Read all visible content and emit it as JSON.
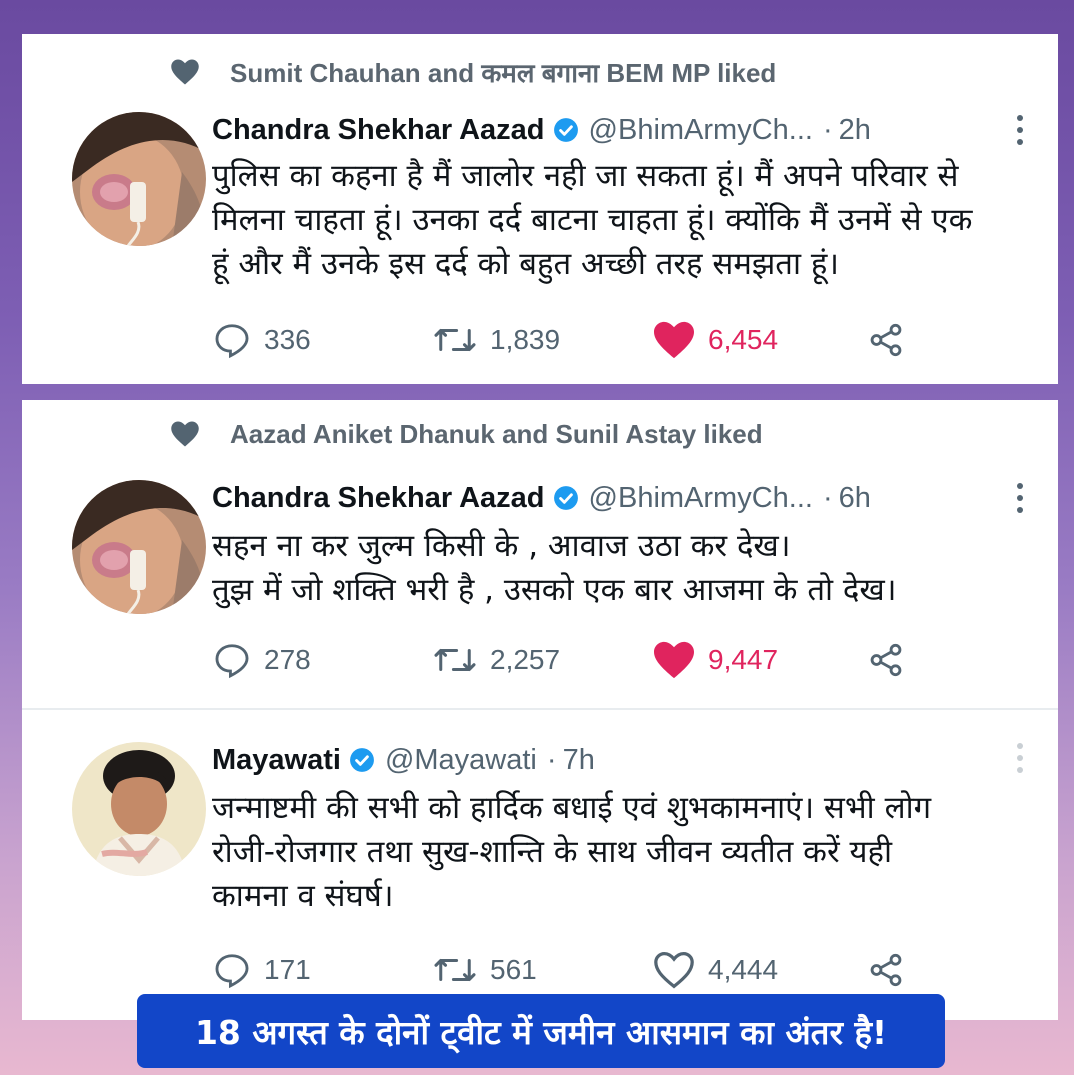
{
  "tweets": [
    {
      "social_context": "Sumit Chauhan and कमल बगाना BEM MP liked",
      "author_name": "Chandra Shekhar Aazad",
      "handle": "@BhimArmyCh...",
      "time": "2h",
      "lines": [
        "पुलिस का कहना है मैं जालोर नही जा सकता हूं। मैं अपने परिवार से",
        "मिलना चाहता हूं। उनका दर्द बाटना चाहता हूं। क्योंकि मैं उनमें से एक",
        "हूं और मैं उनके इस दर्द को बहुत  अच्छी तरह समझता हूं।"
      ],
      "replies": "336",
      "retweets": "1,839",
      "likes": "6,454",
      "liked": true
    },
    {
      "social_context": "Aazad Aniket Dhanuk and Sunil Astay liked",
      "author_name": "Chandra Shekhar Aazad",
      "handle": "@BhimArmyCh...",
      "time": "6h",
      "lines": [
        "सहन ना कर जुल्म किसी के , आवाज उठा कर देख।",
        "तुझ में जो शक्ति भरी है , उसको एक बार आजमा के तो देख।"
      ],
      "replies": "278",
      "retweets": "2,257",
      "likes": "9,447",
      "liked": true
    },
    {
      "author_name": "Mayawati",
      "handle": "@Mayawati",
      "time": "7h",
      "lines": [
        "जन्माष्टमी की सभी को हार्दिक बधाई एवं शुभकामनाएं। सभी लोग",
        "रोजी-रोजगार तथा सुख-शान्ति के साथ जीवन व्यतीत करें यही",
        "कामना व संघर्ष।"
      ],
      "replies": "171",
      "retweets": "561",
      "likes": "4,444",
      "liked": false
    }
  ],
  "banner_text": "18 अगस्त के दोनों ट्वीट में जमीन आसमान का अंतर है!",
  "colors": {
    "like_red": "#e0245e",
    "verified_blue": "#1d9bf0",
    "banner_blue": "#1246c8",
    "muted_gray": "#536471"
  },
  "icons": [
    "heart-icon",
    "verified-badge-icon",
    "more-icon",
    "reply-icon",
    "retweet-icon",
    "like-icon",
    "share-icon"
  ]
}
